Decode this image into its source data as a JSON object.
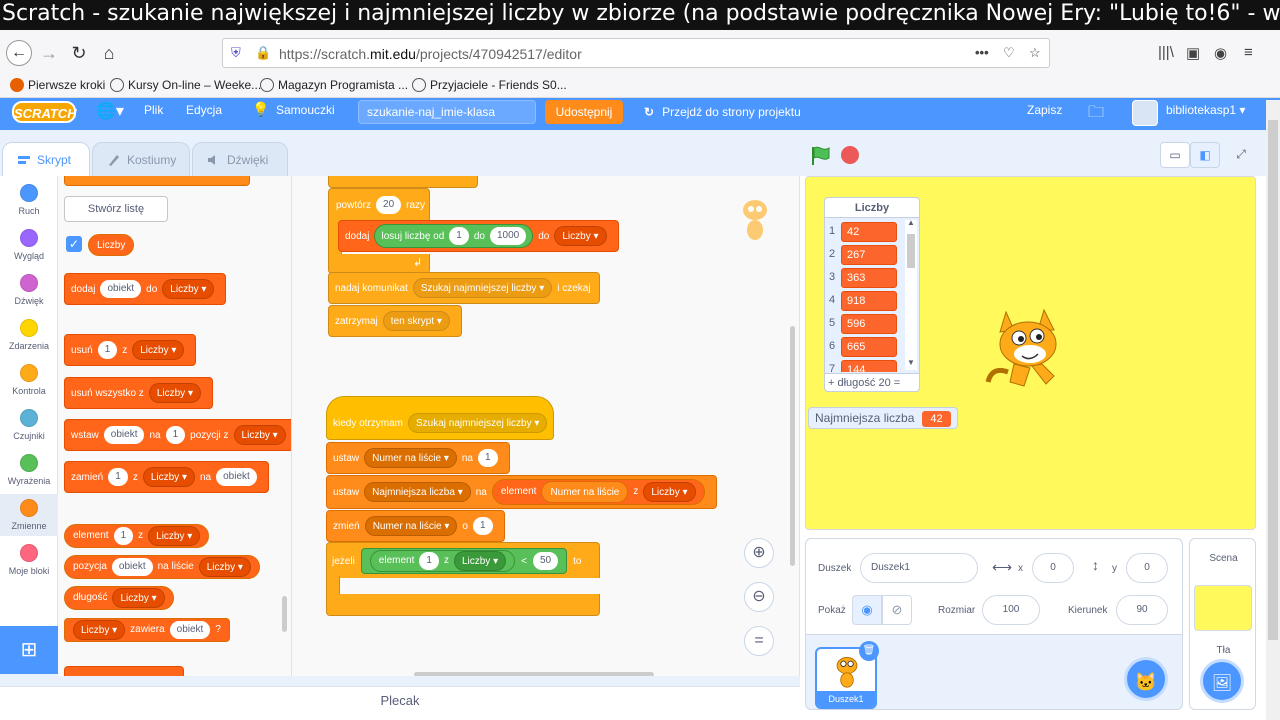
{
  "video_title": "Scratch - szukanie największej i najmniejszej liczby w zbiorze (na podstawie podręcznika Nowej Ery: \"Lubię to!6\" - wyd. 2019 r.)",
  "browser": {
    "url_prefix": "https://scratch.",
    "url_domain": "mit.edu",
    "url_suffix": "/projects/470942517/editor",
    "bookmarks": [
      "Pierwsze kroki",
      "Kursy On-line – Weeke...",
      "Magazyn Programista ...",
      "Przyjaciele - Friends S0..."
    ]
  },
  "menubar": {
    "logo": "SCRATCH",
    "file": "Plik",
    "edit": "Edycja",
    "tutorials": "Samouczki",
    "project_title": "szukanie-naj_imie-klasa",
    "share": "Udostępnij",
    "go_to_project": "Przejdź do strony projektu",
    "save": "Zapisz",
    "username": "bibliotekasp1"
  },
  "tabs": [
    "Skrypt",
    "Kostiumy",
    "Dźwięki"
  ],
  "categories": [
    {
      "label": "Ruch",
      "color": "#4c97ff"
    },
    {
      "label": "Wygląd",
      "color": "#9966ff"
    },
    {
      "label": "Dźwięk",
      "color": "#cf63cf"
    },
    {
      "label": "Zdarzenia",
      "color": "#ffd500"
    },
    {
      "label": "Kontrola",
      "color": "#ffab19"
    },
    {
      "label": "Czujniki",
      "color": "#5cb1d6"
    },
    {
      "label": "Wyrażenia",
      "color": "#59c059"
    },
    {
      "label": "Zmienne",
      "color": "#ff8c1a"
    },
    {
      "label": "Moje bloki",
      "color": "#ff6680"
    }
  ],
  "palette": {
    "make_list": "Stwórz listę",
    "list_name": "Liczby",
    "add": {
      "a": "dodaj",
      "b": "obiekt",
      "c": "do",
      "d": "Liczby"
    },
    "delete": {
      "a": "usuń",
      "b": "1",
      "c": "z",
      "d": "Liczby"
    },
    "delete_all": {
      "a": "usuń wszystko z",
      "b": "Liczby"
    },
    "insert": {
      "a": "wstaw",
      "b": "obiekt",
      "c": "na",
      "d": "1",
      "e": "pozycji z",
      "f": "Liczby"
    },
    "replace": {
      "a": "zamień",
      "b": "1",
      "c": "z",
      "d": "Liczby",
      "e": "na",
      "f": "obiekt"
    },
    "item": {
      "a": "element",
      "b": "1",
      "c": "z",
      "d": "Liczby"
    },
    "position": {
      "a": "pozycja",
      "b": "obiekt",
      "c": "na liście",
      "d": "Liczby"
    },
    "length": {
      "a": "długość",
      "b": "Liczby"
    },
    "contains": {
      "a": "Liczby",
      "b": "zawiera",
      "c": "obiekt",
      "d": "?"
    }
  },
  "script1": {
    "repeat": {
      "a": "powtórz",
      "b": "20",
      "c": "razy"
    },
    "add": {
      "a": "dodaj",
      "b": "losuj liczbę od",
      "c": "1",
      "d": "do",
      "e": "1000",
      "f": "do",
      "g": "Liczby"
    },
    "broadcast": {
      "a": "nadaj komunikat",
      "b": "Szukaj najmniejszej liczby",
      "c": "i czekaj"
    },
    "stop": {
      "a": "zatrzymaj",
      "b": "ten skrypt"
    }
  },
  "script2": {
    "hat": {
      "a": "kiedy otrzymam",
      "b": "Szukaj najmniejszej liczby"
    },
    "set1": {
      "a": "ustaw",
      "b": "Numer na liście",
      "c": "na",
      "d": "1"
    },
    "set2": {
      "a": "ustaw",
      "b": "Najmniejsza liczba",
      "c": "na",
      "d": "element",
      "e": "Numer na liście",
      "f": "z",
      "g": "Liczby"
    },
    "change": {
      "a": "zmień",
      "b": "Numer na liście",
      "c": "o",
      "d": "1"
    },
    "if": {
      "a": "jeżeli",
      "b": "element",
      "c": "1",
      "d": "z",
      "e": "Liczby",
      "f": "<",
      "g": "50",
      "h": "to"
    }
  },
  "backpack": "Plecak",
  "stage": {
    "list_title": "Liczby",
    "list_items": [
      {
        "i": "1",
        "v": "42"
      },
      {
        "i": "2",
        "v": "267"
      },
      {
        "i": "3",
        "v": "363"
      },
      {
        "i": "4",
        "v": "918"
      },
      {
        "i": "5",
        "v": "596"
      },
      {
        "i": "6",
        "v": "665"
      },
      {
        "i": "7",
        "v": "144"
      }
    ],
    "list_footer": "+  długość 20  =",
    "var_label": "Najmniejsza liczba",
    "var_value": "42"
  },
  "sprite_info": {
    "sprite_label": "Duszek",
    "sprite_name": "Duszek1",
    "x_label": "x",
    "x": "0",
    "y_label": "y",
    "y": "0",
    "show_label": "Pokaż",
    "size_label": "Rozmiar",
    "size": "100",
    "direction_label": "Kierunek",
    "direction": "90",
    "thumb_name": "Duszek1"
  },
  "stage_pane": {
    "title": "Scena",
    "backdrops": "Tła"
  }
}
